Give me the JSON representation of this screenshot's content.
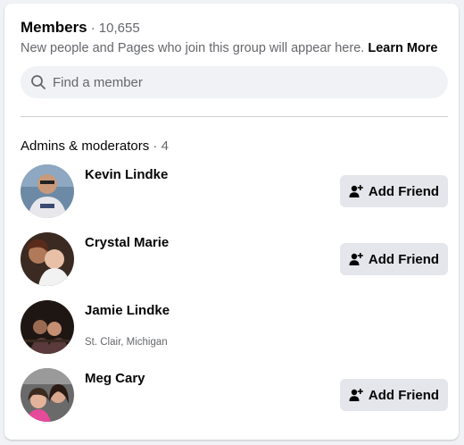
{
  "header": {
    "title": "Members",
    "count": "· 10,655",
    "subtitle": "New people and Pages who join this group will appear here.",
    "learn_more": "Learn More"
  },
  "search": {
    "placeholder": "Find a member",
    "icon": "search-icon"
  },
  "section": {
    "title": "Admins & moderators",
    "count": "· 4"
  },
  "members": [
    {
      "name": "Kevin Lindke",
      "meta": "",
      "action": "Add Friend"
    },
    {
      "name": "Crystal Marie",
      "meta": "",
      "action": "Add Friend"
    },
    {
      "name": "Jamie Lindke",
      "meta": "St. Clair, Michigan",
      "action": ""
    },
    {
      "name": "Meg Cary",
      "meta": "",
      "action": "Add Friend"
    }
  ],
  "colors": {
    "background": "#f0f2f5",
    "card": "#ffffff",
    "secondary_text": "#65676b",
    "button": "#e4e6eb"
  }
}
